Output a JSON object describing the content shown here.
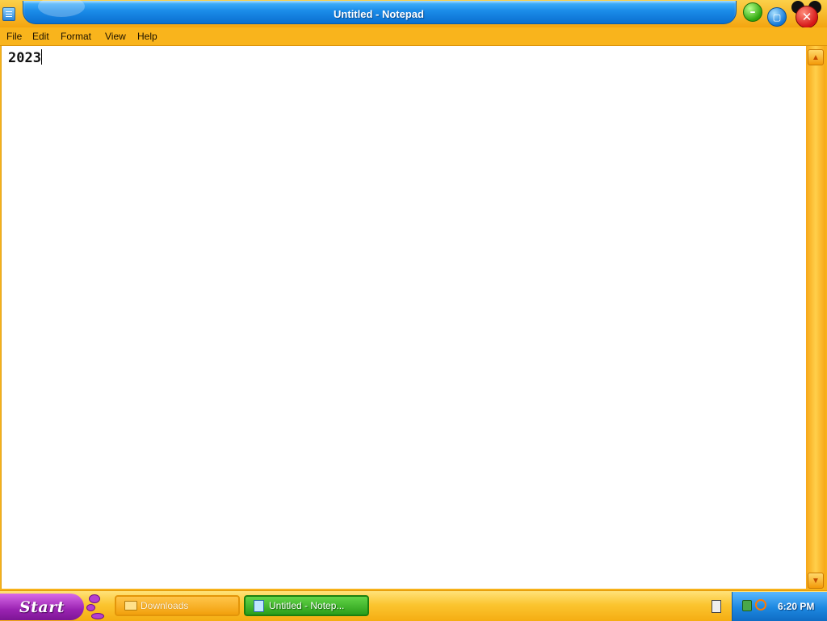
{
  "window": {
    "title": "Untitled - Notepad",
    "icon": "notepad-icon"
  },
  "title_buttons": {
    "minimize_icon": "minimize-icon",
    "maximize_icon": "maximize-icon",
    "close_icon": "close-icon"
  },
  "menu": {
    "items": [
      {
        "label": "File"
      },
      {
        "label": "Edit"
      },
      {
        "label": "Format"
      },
      {
        "label": "View"
      },
      {
        "label": "Help"
      }
    ]
  },
  "editor": {
    "content": "2023"
  },
  "scrollbar": {
    "up_icon": "scroll-up-arrow-icon",
    "down_icon": "scroll-down-arrow-icon"
  },
  "taskbar": {
    "start_label": "Start",
    "tasks": [
      {
        "label": "Downloads",
        "icon": "folder-icon",
        "active": false
      },
      {
        "label": "Untitled - Notep...",
        "icon": "notepad-icon",
        "active": true
      }
    ],
    "tray": {
      "clock": "6:20 PM"
    }
  },
  "colors": {
    "title_blue": "#1a8be8",
    "frame_orange": "#f7b21a",
    "start_purple": "#9a23b2",
    "active_task_green": "#2b9e1a"
  }
}
